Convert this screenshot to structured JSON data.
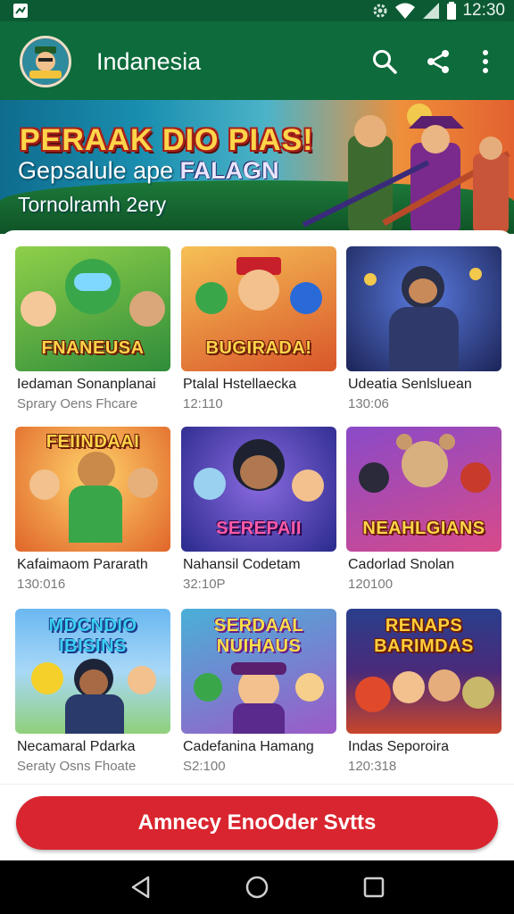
{
  "status_bar": {
    "time": "12:30",
    "icons": [
      "notification-icon",
      "settings-icon",
      "wifi-icon",
      "signal-icon",
      "battery-icon"
    ]
  },
  "app_bar": {
    "title": "Indanesia",
    "icons": [
      "search-icon",
      "share-icon",
      "more-vert-icon"
    ]
  },
  "banner": {
    "title": "PERAAK DIO PIAS!",
    "subtitle_prefix": "Gepsalule ape ",
    "subtitle_highlight": "FALAGN",
    "tagline": "Tornolramh 2ery"
  },
  "games": [
    {
      "logo": "FNANEUSA",
      "title": "Iedaman Sonanplanai",
      "meta": "Sprary Oens Fhcare",
      "colors": [
        "#7cc142",
        "#2f8c3a"
      ]
    },
    {
      "logo": "BUGIRADA!",
      "title": "Ptalal Hstellaecka",
      "meta": "12:110",
      "colors": [
        "#f2a43a",
        "#d9562a"
      ]
    },
    {
      "logo": "",
      "title": "Udeatia Senlsluean",
      "meta": "130:06",
      "colors": [
        "#3a4f9c",
        "#1c2457"
      ]
    },
    {
      "logo": "FEIINDAAI",
      "title": "Kafaimaom Pararath",
      "meta": "130:016",
      "colors": [
        "#f0a93a",
        "#e0652a"
      ]
    },
    {
      "logo": "SEREPAII",
      "title": "Nahansil Codetam",
      "meta": "32:10P",
      "colors": [
        "#3a4fb8",
        "#4b2a8c"
      ]
    },
    {
      "logo": "NEAHLGIANS",
      "title": "Cadorlad Snolan",
      "meta": "120100",
      "colors": [
        "#7b4ab8",
        "#c24a8a"
      ]
    },
    {
      "logo": "MDCNDIO IBISINS",
      "title": "Necamaral Pdarka",
      "meta": "Seraty Osns Fhoate",
      "colors": [
        "#59a8e0",
        "#8fd07a"
      ]
    },
    {
      "logo": "SERDAAL NUIHAUS",
      "title": "Cadefanina Hamang",
      "meta": "S2:100",
      "colors": [
        "#4ab0d8",
        "#9c5ac8"
      ]
    },
    {
      "logo": "RENAPS BARIMDAS",
      "title": "Indas Seporoira",
      "meta": "120:318",
      "colors": [
        "#2a3f8c",
        "#c8452a"
      ]
    }
  ],
  "cta": {
    "label": "Amnecy EnoOder Svtts",
    "color": "#d9252f"
  },
  "nav_bar": {
    "icons": [
      "back-icon",
      "home-icon",
      "recents-icon"
    ]
  },
  "theme": {
    "primary": "#0d6b3c",
    "status": "#0c5a34",
    "accent": "#d9252f"
  }
}
